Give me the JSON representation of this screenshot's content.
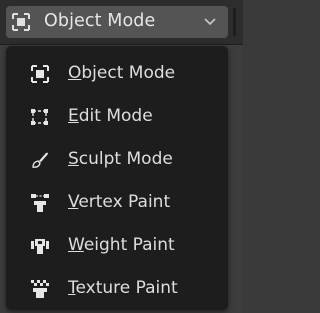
{
  "header": {
    "mode_dropdown": {
      "selected": "Object Mode",
      "icon": "object-mode-icon",
      "chevron_icon": "chevron-down-icon"
    }
  },
  "menu": {
    "items": [
      {
        "label": "Object Mode",
        "icon": "object-mode-icon",
        "mnemonic": "O"
      },
      {
        "label": "Edit Mode",
        "icon": "edit-mode-icon",
        "mnemonic": "E"
      },
      {
        "label": "Sculpt Mode",
        "icon": "sculpt-mode-icon",
        "mnemonic": "S"
      },
      {
        "label": "Vertex Paint",
        "icon": "vertex-paint-icon",
        "mnemonic": "V"
      },
      {
        "label": "Weight Paint",
        "icon": "weight-paint-icon",
        "mnemonic": "W"
      },
      {
        "label": "Texture Paint",
        "icon": "texture-paint-icon",
        "mnemonic": "T"
      }
    ]
  },
  "colors": {
    "menu_bg": "#1d1d1d",
    "dropdown_bg": "#545454",
    "text": "#dedede"
  }
}
